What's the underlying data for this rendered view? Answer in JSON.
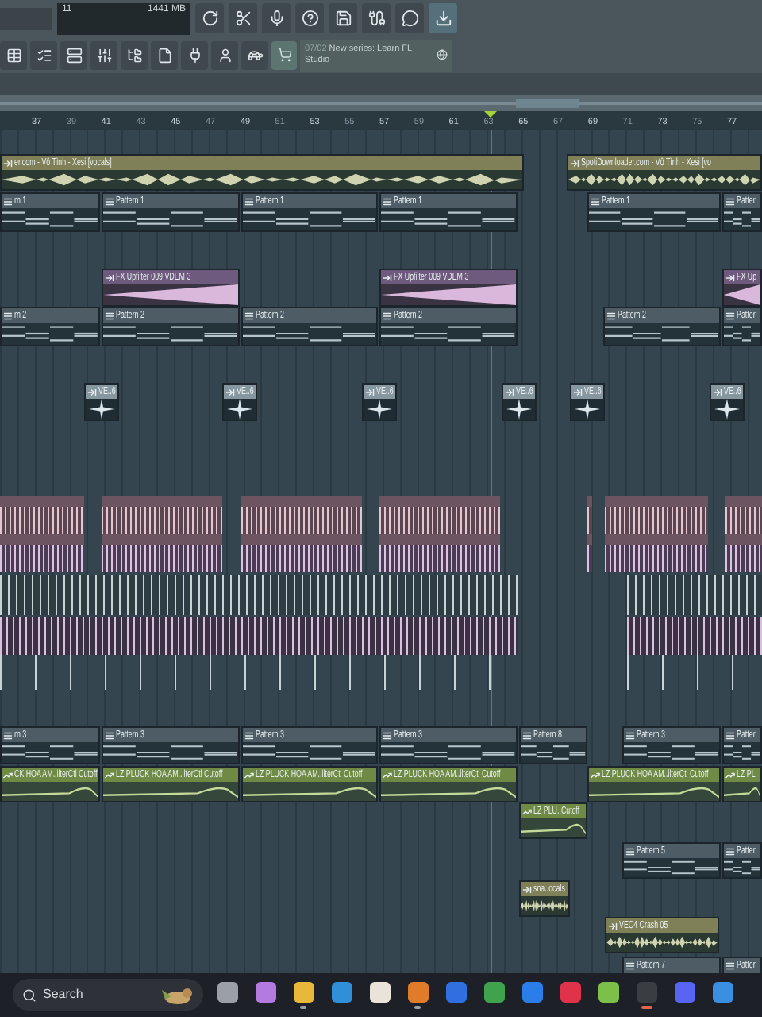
{
  "toolbar": {
    "cpu": "11",
    "memory": "1441 MB",
    "news": {
      "date": "07/02",
      "text": "New series: Learn FL Studio"
    }
  },
  "ruler": {
    "marks": [
      "37",
      "39",
      "41",
      "43",
      "45",
      "47",
      "49",
      "51",
      "53",
      "55",
      "57",
      "59",
      "61",
      "63",
      "65",
      "67",
      "69",
      "71",
      "73",
      "75",
      "77"
    ]
  },
  "tracks": [
    {
      "kind": "audio",
      "clips": [
        {
          "label": "er.com - Vô Tình - Xesi [vocals]"
        },
        {
          "label": "SpotiDownloader.com - Vô Tình - Xesi [vo"
        }
      ]
    },
    {
      "kind": "pattern",
      "clips": [
        {
          "label": "rn 1"
        },
        {
          "label": "Pattern 1"
        },
        {
          "label": "Pattern 1"
        },
        {
          "label": "Pattern 1"
        },
        {
          "label": "Pattern 1"
        },
        {
          "label": "Patter"
        }
      ]
    },
    {
      "kind": "fx",
      "clips": [
        {
          "label": "FX Upfilter 009 VDEM 3"
        },
        {
          "label": "FX Upfilter 009 VDEM 3"
        },
        {
          "label": "FX Up"
        }
      ]
    },
    {
      "kind": "pattern",
      "clips": [
        {
          "label": "rn 2"
        },
        {
          "label": "Pattern 2"
        },
        {
          "label": "Pattern 2"
        },
        {
          "label": "Pattern 2"
        },
        {
          "label": "Pattern 2"
        },
        {
          "label": "Patter"
        }
      ]
    },
    {
      "kind": "oneshot",
      "clips": [
        {
          "label": "VE..6"
        },
        {
          "label": "VE..6"
        },
        {
          "label": "VE..6"
        },
        {
          "label": "VE..6"
        },
        {
          "label": "VE..6"
        },
        {
          "label": "VE..6"
        }
      ]
    },
    {
      "kind": "pattern",
      "clips": [
        {
          "label": "rn 3"
        },
        {
          "label": "Pattern 3"
        },
        {
          "label": "Pattern 3"
        },
        {
          "label": "Pattern 3"
        },
        {
          "label": "Pattern 8"
        },
        {
          "label": "Pattern 3"
        },
        {
          "label": "Patter"
        }
      ]
    },
    {
      "kind": "automation",
      "clips": [
        {
          "label": "CK HOA AM..ilterCtl Cutoff"
        },
        {
          "label": "LZ PLUCK HOA AM..ilterCtl Cutoff"
        },
        {
          "label": "LZ PLUCK HOA AM..ilterCtl Cutoff"
        },
        {
          "label": "LZ PLUCK HOA AM..ilterCtl Cutoff"
        },
        {
          "label": "LZ PLUCK HOA AM..ilterCtl Cutoff"
        },
        {
          "label": "LZ PL"
        }
      ]
    },
    {
      "kind": "automation",
      "clips": [
        {
          "label": "LZ PLU..Cutoff"
        }
      ]
    },
    {
      "kind": "pattern",
      "clips": [
        {
          "label": "Pattern 5"
        },
        {
          "label": "Patter"
        }
      ]
    },
    {
      "kind": "audio",
      "clips": [
        {
          "label": "sna..ocals"
        }
      ]
    },
    {
      "kind": "audio",
      "clips": [
        {
          "label": "VEC4 Crash 05"
        }
      ]
    },
    {
      "kind": "pattern",
      "clips": [
        {
          "label": "Pattern 7"
        },
        {
          "label": "Patter"
        }
      ]
    }
  ],
  "taskbar": {
    "search": {
      "placeholder": "Search"
    },
    "apps": [
      {
        "running": false
      },
      {
        "running": false
      },
      {
        "running": true
      },
      {
        "running": false
      },
      {
        "running": false
      },
      {
        "running": true
      },
      {
        "running": false
      },
      {
        "running": false
      },
      {
        "running": false
      },
      {
        "running": false
      },
      {
        "running": false
      },
      {
        "running": true
      },
      {
        "running": false
      },
      {
        "running": false
      }
    ]
  }
}
